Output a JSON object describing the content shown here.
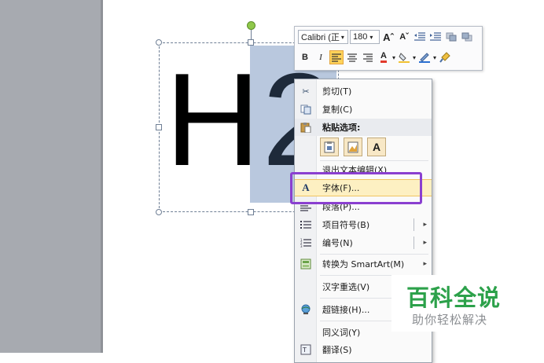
{
  "slide": {
    "text_plain": "H",
    "text_selected": "2"
  },
  "mini_toolbar": {
    "font_name": "Calibri (正",
    "font_size": "180",
    "grow_font": "Aˆ",
    "shrink_font": "Aˇ",
    "bold": "B",
    "italic": "I",
    "font_color_letter": "A"
  },
  "context_menu": {
    "items": [
      {
        "label": "剪切(T)",
        "icon": "scissors-icon"
      },
      {
        "label": "复制(C)",
        "icon": "copy-icon"
      },
      {
        "label": "粘贴选项:",
        "icon": "paste-icon"
      },
      {
        "label": "退出文本编辑(X)",
        "icon": ""
      },
      {
        "label": "字体(F)...",
        "icon": "font-icon"
      },
      {
        "label": "段落(P)...",
        "icon": "paragraph-icon"
      },
      {
        "label": "项目符号(B)",
        "icon": "bullets-icon"
      },
      {
        "label": "编号(N)",
        "icon": "numbering-icon"
      },
      {
        "label": "转换为 SmartArt(M)",
        "icon": "smartart-icon"
      },
      {
        "label": "汉字重选(V)",
        "icon": ""
      },
      {
        "label": "超链接(H)...",
        "icon": "hyperlink-icon"
      },
      {
        "label": "同义词(Y)",
        "icon": ""
      },
      {
        "label": "翻译(S)",
        "icon": "translate-icon"
      }
    ],
    "paste_option_letter": "A"
  },
  "watermark": {
    "title": "百科全说",
    "subtitle": "助你轻松解决"
  },
  "colors": {
    "highlight_box": "#8a3fd0",
    "watermark_green": "#2ca14a",
    "selection": "#b9c8de"
  }
}
